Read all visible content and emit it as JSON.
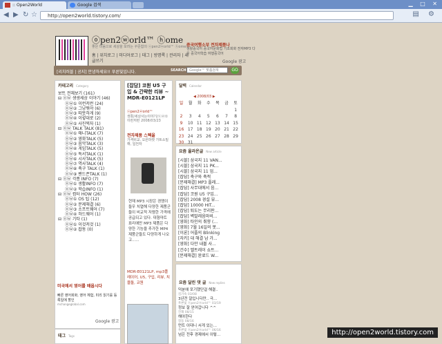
{
  "browser": {
    "tabs": [
      {
        "label": ":: Open2World"
      },
      {
        "label": "Google 검색"
      }
    ],
    "url": "http://open2world.tistory.com/",
    "window_buttons": "▁ □ ✕"
  },
  "header": {
    "logo_title": "ⓞpen2ⓦorld™ ⓗome",
    "logo_sub": "좋은 미음으로 세상을 보려는 꾸준함의 ⓞpen2ⓦorld™ ⓗome!",
    "nav": "홈 | 위치로그 | 미디어로그 | 태그 | 방명록 | 관리자 | 새글쓰기",
    "ad_title": "중국여행소부 전자제품나",
    "ad_body": "생활중국어 중국어문화법 기초회화 전자MP3 다운 중국어학습 여행중국어",
    "ad_google": "Google 광고"
  },
  "notice": {
    "text": "[리치러블 | 공지] 안녕하세요!! 푸른빛입니다.",
    "search_label": "SEARCH",
    "search_placeholder": "Google™ 맞춤검색",
    "go": "GO"
  },
  "category": {
    "title": "카테고리",
    "sub": "Category",
    "items": [
      {
        "label": "보트 전체보기 (161)",
        "red": false
      },
      {
        "label": "⊟ ⓞⓦ 생생세상 이야기 (46)",
        "red": false
      },
      {
        "label": "ⓞⓦ① 이런저런 (24)",
        "red": false
      },
      {
        "label": "ⓞⓦ② 그냥뭐야 (6)",
        "red": false
      },
      {
        "label": "ⓞⓦ③ 따뜻하게 (9)",
        "red": false
      },
      {
        "label": "ⓞⓦ④ 이렇대로 (2)",
        "red": false
      },
      {
        "label": "ⓞⓦ⑤ 사진찍자 (1)",
        "red": false
      },
      {
        "label": "⊟ ⓞⓦ TALK TALK (81)",
        "red": false
      },
      {
        "label": "ⓞⓦ① 애니TALK (7)",
        "red": false
      },
      {
        "label": "ⓞⓦ② 영화TALK (5)",
        "red": false
      },
      {
        "label": "ⓞⓦ③ 음악TALK (3)",
        "red": false
      },
      {
        "label": "ⓞⓦ④ 게임TALK (5)",
        "red": false
      },
      {
        "label": "ⓞⓦ⑤ 독서TALK (1)",
        "red": false
      },
      {
        "label": "ⓞⓦ⑥ 시사TALK (5)",
        "red": false
      },
      {
        "label": "ⓞⓦ⑦ 역사TALK (4)",
        "red": false
      },
      {
        "label": "ⓞⓦ⑧ 축구 TALK (1)",
        "red": false
      },
      {
        "label": "ⓞⓦ⑨ 밴드존TALK (1)",
        "red": false
      },
      {
        "label": "⊟ ⓞⓦ 각종 INFO (7)",
        "red": false
      },
      {
        "label": "ⓞⓦ① 생활INFO (7)",
        "red": false
      },
      {
        "label": "ⓞⓦ② 학습INFO (1)",
        "red": false
      },
      {
        "label": "⊟ ⓞⓦ 컴터 HOW (26)",
        "red": false
      },
      {
        "label": "ⓞⓦ① OS 팁 (12)",
        "red": false
      },
      {
        "label": "ⓞⓦ② 문제해결 (6)",
        "red": false
      },
      {
        "label": "ⓞⓦ③ 소프트웨어 (7)",
        "red": false
      },
      {
        "label": "ⓞⓦ④ 하드웨어 (1)",
        "red": false
      },
      {
        "label": "⊟ ⓞⓦ 기타 (1)",
        "red": false
      },
      {
        "label": "ⓞⓦ① 이것저것 (1)",
        "red": false
      },
      {
        "label": "ⓞⓦ② 잡동 (0)",
        "red": false
      }
    ],
    "ad_title": "미국에서 영어를 배웁시다",
    "ad_text": "빠른 영어회화, 영어 체험, 미리 읽기를 등록일에 할인",
    "ad_url": "mchangeglobal.com",
    "ad_google": "Google 광고",
    "tag_title": "태그",
    "tag_sub": "Tags"
  },
  "post": {
    "title": "[잡담] 코원 U5 구입 & 간략한 리뷰 ~ MDR-E0121LP",
    "author": "ⓞpen2ⓦorld™",
    "meta": "생활/세상사는이야기/ⓞⓦ① 이런저런 2008/03/23",
    "title2": "전자제품 스펙을",
    "sub2": "가격비교, 오픈마켓 가트소밀해, 일전자",
    "body": "현재 MP3 시장은 경쟁이 들우 치열해 다양한 제품군들이 비교적 저렴한 가격에 공급되고 있다. 대형마트 표리에만 MP3 제품은 다양한 기능을 추가한 MP4 제품군들도 다양하게 나오고......",
    "tags": "MDR-E0121LP, mp3플레이어, U5, 구입, 리뷰, 치블돌, 코원"
  },
  "calendar": {
    "title": "달력",
    "sub": "Calendar",
    "month": "◀ 2008/03 ▶",
    "weekdays": [
      "일",
      "월",
      "화",
      "수",
      "목",
      "금",
      "토"
    ],
    "weeks": [
      [
        "",
        "",
        "",
        "",
        "",
        "",
        "1"
      ],
      [
        "2",
        "3",
        "4",
        "5",
        "6",
        "7",
        "8"
      ],
      [
        "9",
        "10",
        "11",
        "12",
        "13",
        "14",
        "15"
      ],
      [
        "16",
        "17",
        "18",
        "19",
        "20",
        "21",
        "22"
      ],
      [
        "23",
        "24",
        "25",
        "26",
        "27",
        "28",
        "29"
      ],
      [
        "30",
        "31",
        "",
        "",
        "",
        "",
        ""
      ]
    ]
  },
  "recent": {
    "title": "요즘 올라온글",
    "sub": "New article",
    "items": [
      "[시블] 삼국지 11 VAN...",
      "[시블] 삼국지 11 PK...",
      "[시블] 삼국지 11 업...",
      "[잡담] 축구와 축적",
      "[문제해결] MP3 플레...",
      "[잡담] 사무대에서 음...",
      "[잡담] 코원 U5 구입...",
      "[잡담] 2008 경설 뷰...",
      "[잡담] 10000 HIT...",
      "[잡담] 퇴도는 무리판...",
      "[잡담] 벽발레음마비...",
      "[영화] 타인의 취향 (...",
      "[영화] 7월 16일의 봇...",
      "[이론] 어플의 Blinking",
      "[자키] 대 해결 남 가...",
      "[영화] 다만 내볼 사...",
      "[건수] 벨트레이 쇼트...",
      "[문제해결] 완료드 W..."
    ]
  },
  "replies": {
    "title": "요즘 달린 댓 글",
    "sub": "New replies",
    "items": [
      {
        "text": "덕분에 포기했단걸 해결..",
        "meta": "김기숙 03/08"
      },
      {
        "text": "3년전 알입니다만.. 극...",
        "meta": "푸른빛 ⓞpen2ⓦorld™ 03/19"
      },
      {
        "text": "정보 잘 얻어갑니다 ^^",
        "meta": "전재 08/15"
      },
      {
        "text": "해야한다",
        "meta": "정동 08/16"
      },
      {
        "text": "먼트 이대니 서게 있는...",
        "meta": "푸른빛 ⓞpen2ⓦorld™ 06/16"
      },
      {
        "text": "넘은 전후 경제에서 이렇...",
        "meta": ""
      }
    ]
  },
  "watermark": "http://open2world.tistory.com",
  "colors": {
    "accent_red": "#a8321d",
    "notice_bar": "#8c7864",
    "page_bg": "#ddd4c4"
  }
}
